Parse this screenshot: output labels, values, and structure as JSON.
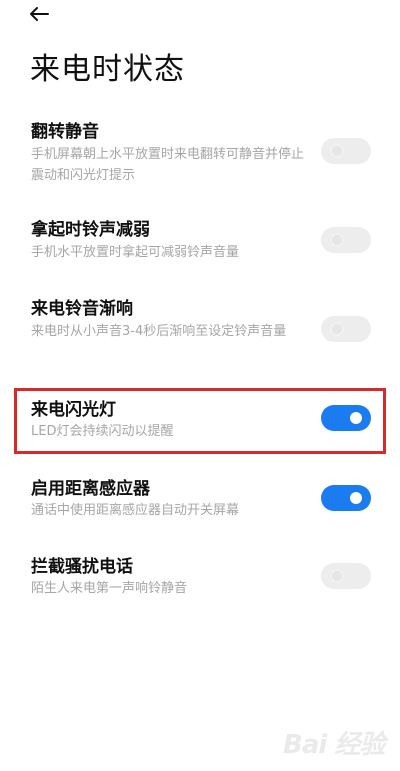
{
  "header": {
    "back_icon": "arrow-left-icon",
    "title": "来电时状态"
  },
  "settings": [
    {
      "title": "翻转静音",
      "description": "手机屏幕朝上水平放置时来电翻转可静音并停止震动和闪光灯提示",
      "enabled": false
    },
    {
      "title": "拿起时铃声减弱",
      "description": "手机水平放置时拿起可减弱铃声音量",
      "enabled": false
    },
    {
      "title": "来电铃音渐响",
      "description": "来电时从小声音3-4秒后渐响至设定铃声音量",
      "enabled": false
    },
    {
      "title": "来电闪光灯",
      "description": "LED灯会持续闪动以提醒",
      "enabled": true
    },
    {
      "title": "启用距离感应器",
      "description": "通话中使用距离感应器自动开关屏幕",
      "enabled": true
    },
    {
      "title": "拦截骚扰电话",
      "description": "陌生人来电第一声响铃静音",
      "enabled": false
    }
  ],
  "colors": {
    "toggle_on": "#1a7cf0",
    "toggle_off": "#ededed",
    "highlight": "#d82a2a"
  },
  "watermark": {
    "text": "Bai 经验"
  }
}
